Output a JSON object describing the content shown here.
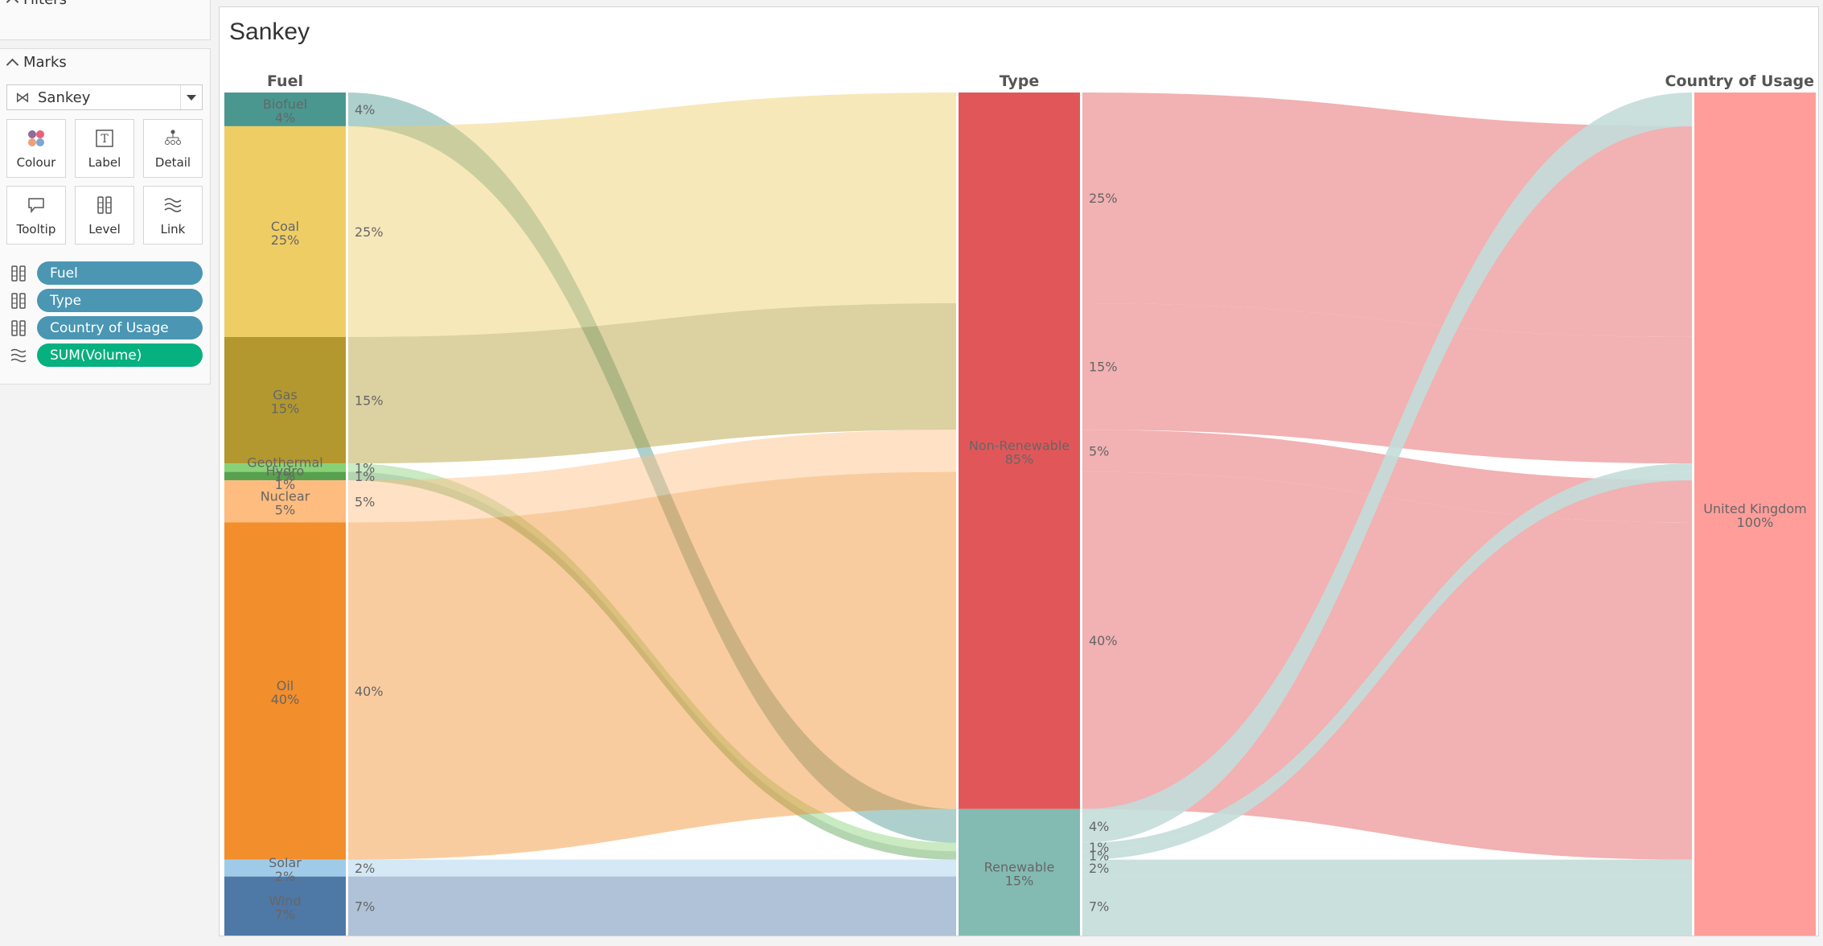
{
  "sidebar": {
    "filters_label": "Filters",
    "marks_label": "Marks",
    "mark_type": "Sankey",
    "mark_type_icon": "sankey-icon",
    "cards": [
      {
        "label": "Colour",
        "icon": "colour-icon"
      },
      {
        "label": "Label",
        "icon": "label-icon"
      },
      {
        "label": "Detail",
        "icon": "detail-icon"
      },
      {
        "label": "Tooltip",
        "icon": "tooltip-icon"
      },
      {
        "label": "Level",
        "icon": "level-icon"
      },
      {
        "label": "Link",
        "icon": "link-icon"
      }
    ],
    "pills": [
      {
        "label": "Fuel",
        "icon": "level-icon",
        "color": "#4a96b3"
      },
      {
        "label": "Type",
        "icon": "level-icon",
        "color": "#4a96b3"
      },
      {
        "label": "Country of Usage",
        "icon": "level-icon",
        "color": "#4a96b3"
      },
      {
        "label": "SUM(Volume)",
        "icon": "link-icon",
        "color": "#06b07f"
      }
    ]
  },
  "chart_data": {
    "type": "sankey",
    "title": "Sankey",
    "levels": [
      {
        "name": "Fuel",
        "nodes": [
          {
            "name": "Biofuel",
            "value": 4,
            "label": "4%",
            "color": "#4a9790"
          },
          {
            "name": "Coal",
            "value": 25,
            "label": "25%",
            "color": "#eecd65"
          },
          {
            "name": "Gas",
            "value": 15,
            "label": "15%",
            "color": "#b2982e"
          },
          {
            "name": "Geothermal",
            "value": 1,
            "label": "1%",
            "color": "#89d176"
          },
          {
            "name": "Hydro",
            "value": 1,
            "label": "1%",
            "color": "#57a14f"
          },
          {
            "name": "Nuclear",
            "value": 5,
            "label": "5%",
            "color": "#febc7f"
          },
          {
            "name": "Oil",
            "value": 40,
            "label": "40%",
            "color": "#f28e2b"
          },
          {
            "name": "Solar",
            "value": 2,
            "label": "2%",
            "color": "#a0cbe8"
          },
          {
            "name": "Wind",
            "value": 7,
            "label": "7%",
            "color": "#4e78a6"
          }
        ]
      },
      {
        "name": "Type",
        "nodes": [
          {
            "name": "Non-Renewable",
            "value": 85,
            "label": "85%",
            "color": "#e15759"
          },
          {
            "name": "Renewable",
            "value": 15,
            "label": "15%",
            "color": "#83bbb3"
          }
        ]
      },
      {
        "name": "Country of Usage",
        "nodes": [
          {
            "name": "United Kingdom",
            "value": 100,
            "label": "100%",
            "color": "#ff9d9a"
          }
        ]
      }
    ],
    "links_fuel_to_type": [
      {
        "source": "Biofuel",
        "target": "Renewable",
        "value": 4,
        "label": "4%"
      },
      {
        "source": "Coal",
        "target": "Non-Renewable",
        "value": 25,
        "label": "25%"
      },
      {
        "source": "Gas",
        "target": "Non-Renewable",
        "value": 15,
        "label": "15%"
      },
      {
        "source": "Geothermal",
        "target": "Renewable",
        "value": 1,
        "label": "1%"
      },
      {
        "source": "Hydro",
        "target": "Renewable",
        "value": 1,
        "label": "1%"
      },
      {
        "source": "Nuclear",
        "target": "Non-Renewable",
        "value": 5,
        "label": "5%"
      },
      {
        "source": "Oil",
        "target": "Non-Renewable",
        "value": 40,
        "label": "40%"
      },
      {
        "source": "Solar",
        "target": "Renewable",
        "value": 2,
        "label": "2%"
      },
      {
        "source": "Wind",
        "target": "Renewable",
        "value": 7,
        "label": "7%"
      }
    ],
    "links_type_to_country": [
      {
        "fuel": "Coal",
        "source": "Non-Renewable",
        "target": "United Kingdom",
        "value": 25,
        "label": "25%"
      },
      {
        "fuel": "Gas",
        "source": "Non-Renewable",
        "target": "United Kingdom",
        "value": 15,
        "label": "15%"
      },
      {
        "fuel": "Nuclear",
        "source": "Non-Renewable",
        "target": "United Kingdom",
        "value": 5,
        "label": "5%"
      },
      {
        "fuel": "Oil",
        "source": "Non-Renewable",
        "target": "United Kingdom",
        "value": 40,
        "label": "40%"
      },
      {
        "fuel": "Biofuel",
        "source": "Renewable",
        "target": "United Kingdom",
        "value": 4,
        "label": "4%"
      },
      {
        "fuel": "Geothermal",
        "source": "Renewable",
        "target": "United Kingdom",
        "value": 1,
        "label": "1%"
      },
      {
        "fuel": "Hydro",
        "source": "Renewable",
        "target": "United Kingdom",
        "value": 1,
        "label": "1%"
      },
      {
        "fuel": "Solar",
        "source": "Renewable",
        "target": "United Kingdom",
        "value": 2,
        "label": "2%"
      },
      {
        "fuel": "Wind",
        "source": "Renewable",
        "target": "United Kingdom",
        "value": 7,
        "label": "7%"
      }
    ],
    "type_link_colors": {
      "Non-Renewable": "#f1a9aa",
      "Renewable": "#c3ddd9"
    },
    "link_opacity": 0.45
  }
}
